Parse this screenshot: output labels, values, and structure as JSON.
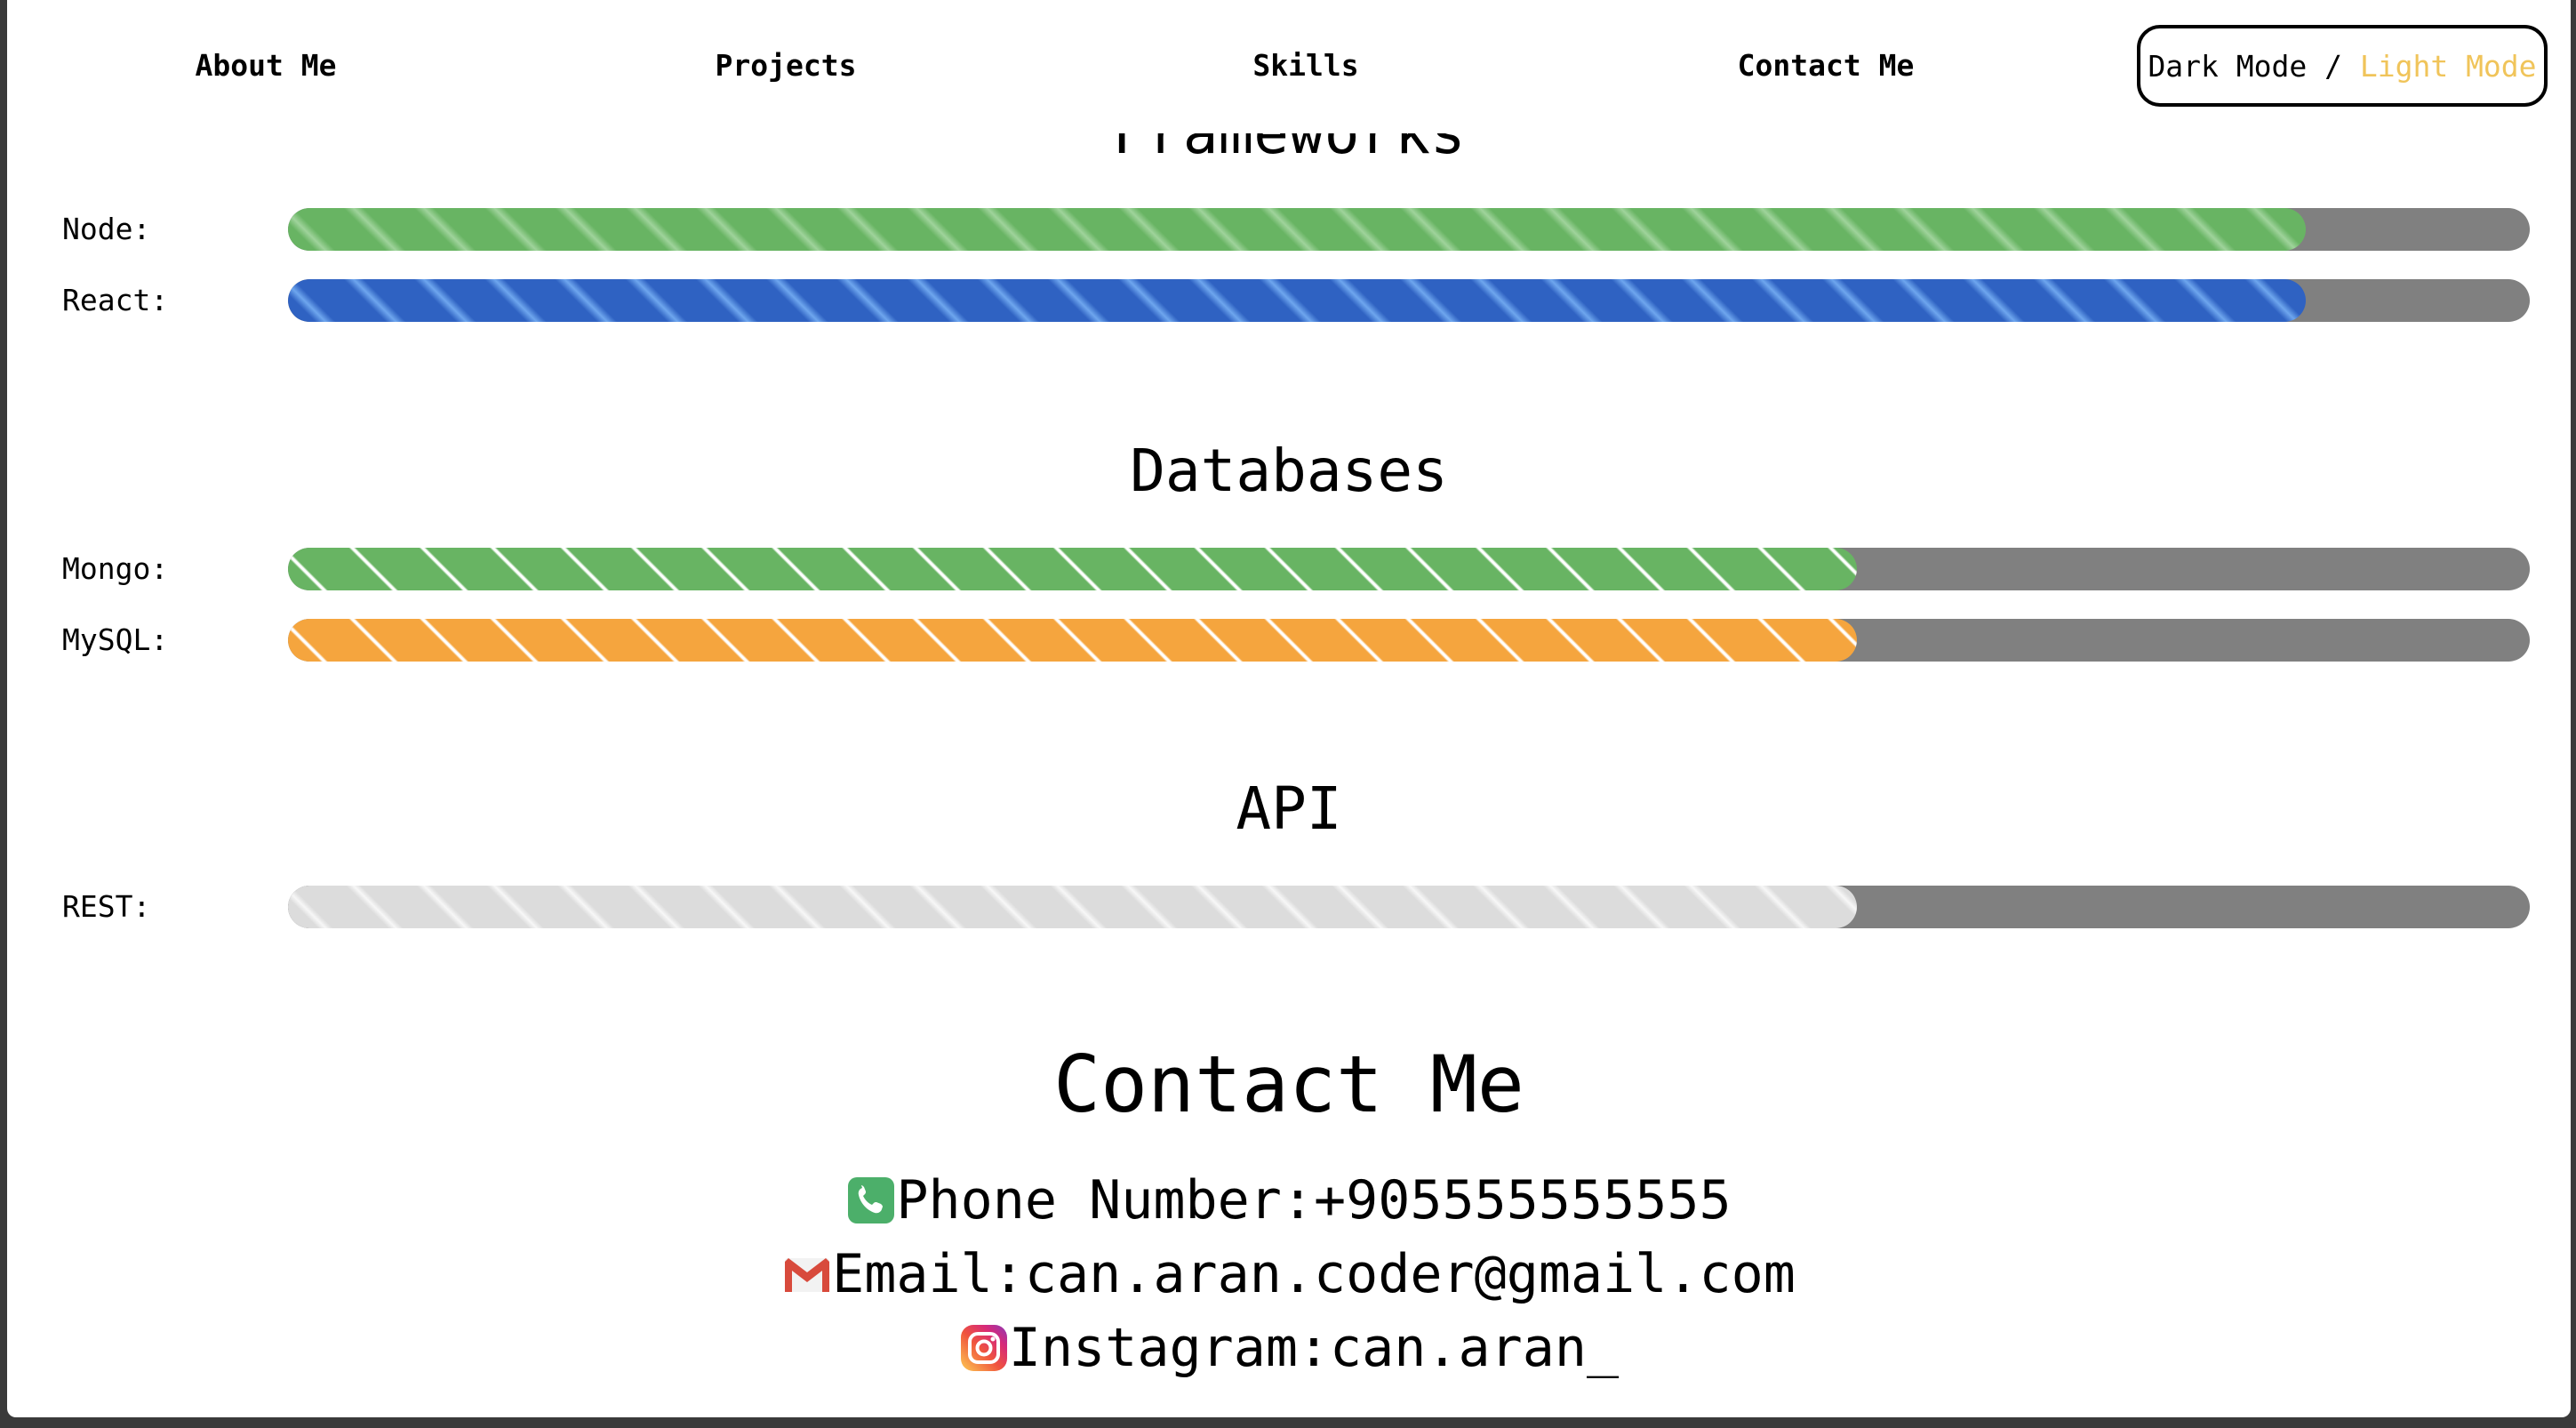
{
  "nav": {
    "about": "About Me",
    "projects": "Projects",
    "skills": "Skills",
    "contact": "Contact Me",
    "mode_dark": "Dark Mode / ",
    "mode_light": "Light Mode"
  },
  "skills": {
    "frameworks_title_clipped": "Frameworks",
    "frameworks": [
      {
        "label": "Node:",
        "level": 0.9
      },
      {
        "label": "React:",
        "level": 0.9
      }
    ],
    "databases_title": "Databases",
    "databases": [
      {
        "label": "Mongo:",
        "level": 0.7
      },
      {
        "label": "MySQL:",
        "level": 0.7
      }
    ],
    "api_title": "API",
    "api": [
      {
        "label": "REST:",
        "level": 0.7
      }
    ]
  },
  "contact": {
    "title": "Contact Me",
    "phone": "Phone Number:+905555555555",
    "email": "Email:can.aran.coder@gmail.com",
    "instagram": "Instagram:can.aran_",
    "icons": [
      "phone-icon",
      "gmail-icon",
      "instagram-icon"
    ]
  },
  "colors": {
    "accent_light_mode": "#f0c45a",
    "node_bar": "#68b463",
    "react_bar": "#2f62c2",
    "mongo_bar": "#68b463",
    "mysql_bar": "#f5a53e",
    "rest_bar": "#dcdcdc",
    "track": "#808080"
  }
}
